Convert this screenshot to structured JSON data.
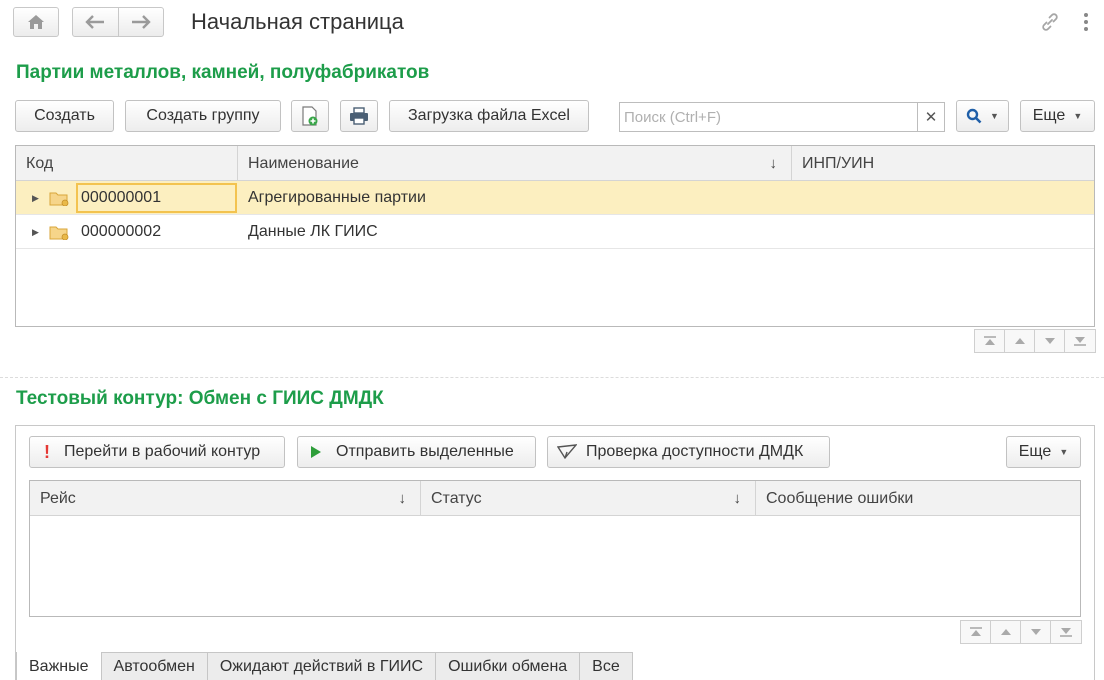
{
  "header": {
    "title": "Начальная страница",
    "home_icon": "home-icon",
    "back_icon": "arrow-left-icon",
    "forward_icon": "arrow-right-icon",
    "link_icon": "link-icon",
    "more_icon": "vertical-dots-icon"
  },
  "batches": {
    "title": "Партии металлов, камней, полуфабрикатов",
    "create_label": "Создать",
    "create_group_label": "Создать группу",
    "excel_label": "Загрузка файла Excel",
    "search_placeholder": "Поиск (Ctrl+F)",
    "more_label": "Еще",
    "columns": {
      "code": "Код",
      "name": "Наименование",
      "sort_arrow": "↓",
      "inn": "ИНП/УИН"
    },
    "rows": [
      {
        "code": "000000001",
        "name": "Агрегированные партии",
        "inn": ""
      },
      {
        "code": "000000002",
        "name": "Данные ЛК ГИИС",
        "inn": ""
      }
    ]
  },
  "exchange": {
    "title": "Тестовый контур: Обмен с ГИИС ДМДК",
    "go_work_label": "Перейти в рабочий контур",
    "send_selected_label": "Отправить выделенные",
    "check_label": "Проверка доступности ДМДК",
    "more_label": "Еще",
    "columns": {
      "trip": "Рейс",
      "status": "Статус",
      "error": "Сообщение ошибки",
      "sort_arrow": "↓"
    }
  },
  "tabs": [
    {
      "label": "Важные",
      "active": true
    },
    {
      "label": "Автообмен",
      "active": false
    },
    {
      "label": "Ожидают действий в ГИИС",
      "active": false
    },
    {
      "label": "Ошибки обмена",
      "active": false
    },
    {
      "label": "Все",
      "active": false
    }
  ],
  "colors": {
    "accent_green": "#1d9d4a",
    "selection": "#fcefc0",
    "selection_border": "#f3c34f",
    "alert_red": "#e53935",
    "play_green": "#2e9e3a",
    "search_blue": "#1f5fa8"
  }
}
